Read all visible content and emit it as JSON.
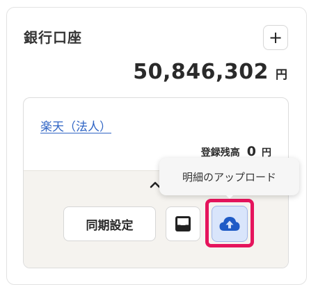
{
  "section": {
    "title": "銀行口座",
    "add_icon": "plus-icon"
  },
  "total": {
    "amount": "50,846,302",
    "unit": "円"
  },
  "account": {
    "name": "楽天（法人）",
    "balance_label": "登録残高",
    "balance_value": "0",
    "balance_unit": "円"
  },
  "actions": {
    "collapse_icon": "chevron-up-icon",
    "sync_label": "同期設定",
    "inbox_icon": "inbox-tray-icon",
    "upload_icon": "cloud-upload-icon",
    "upload_tooltip": "明細のアップロード"
  },
  "colors": {
    "link": "#2f64c4",
    "highlight": "#e5145c",
    "upload_bg": "#d9e5fb",
    "upload_icon": "#1f5bc6",
    "action_area_bg": "#f5f3ef"
  }
}
